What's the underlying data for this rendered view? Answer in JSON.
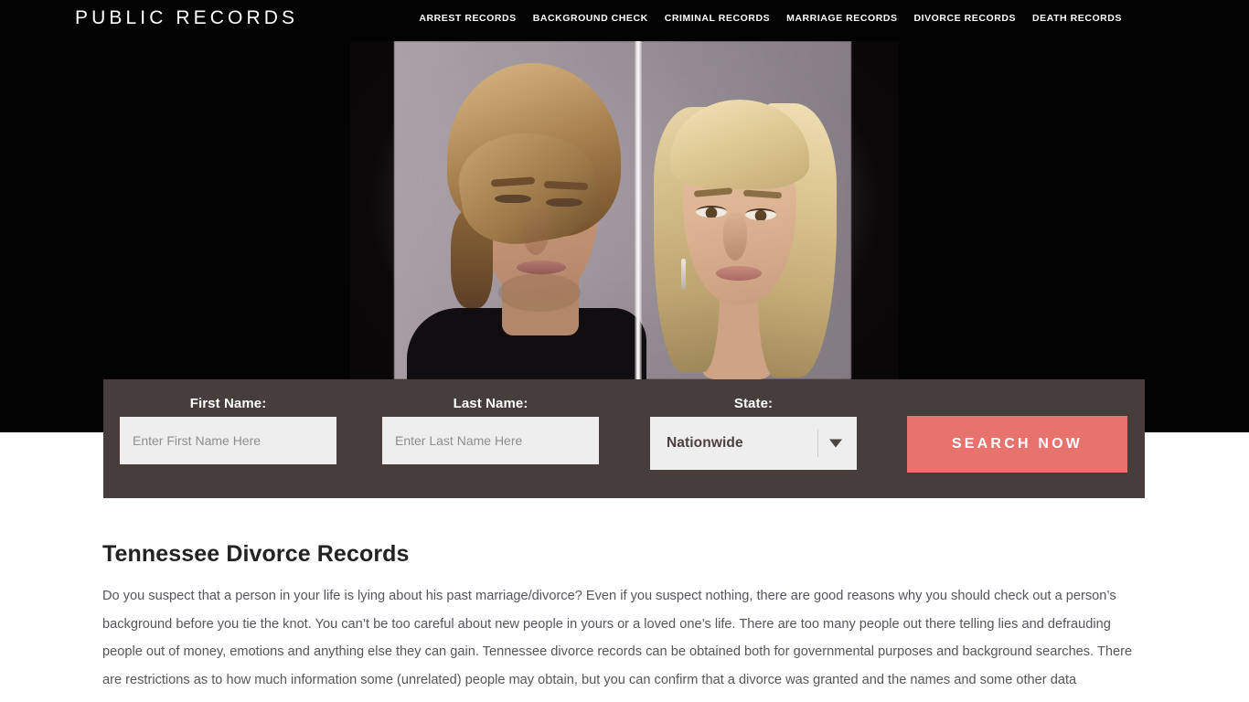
{
  "header": {
    "brand": "PUBLIC RECORDS",
    "nav": [
      {
        "label": "ARREST RECORDS"
      },
      {
        "label": "BACKGROUND CHECK"
      },
      {
        "label": "CRIMINAL RECORDS"
      },
      {
        "label": "MARRIAGE RECORDS"
      },
      {
        "label": "DIVORCE RECORDS"
      },
      {
        "label": "DEATH RECORDS"
      }
    ]
  },
  "hero": {
    "image_alt": "Man and woman facing away from each other split by a bright vertical divider"
  },
  "search_form": {
    "first_name": {
      "label": "First Name:",
      "placeholder": "Enter First Name Here",
      "value": ""
    },
    "last_name": {
      "label": "Last Name:",
      "placeholder": "Enter Last Name Here",
      "value": ""
    },
    "state": {
      "label": "State:",
      "selected": "Nationwide",
      "icon": "chevron-down-icon"
    },
    "submit_label": "SEARCH NOW",
    "colors": {
      "panel": "#473e3c",
      "button": "#e8726c",
      "input": "#eeeeee"
    }
  },
  "article": {
    "title": "Tennessee Divorce Records",
    "body": "Do you suspect that a person in your life is lying about his past marriage/divorce? Even if you suspect nothing, there are good reasons why you should check out a person’s background before you tie the knot. You can’t be too careful about new people in yours or a loved one’s life. There are too many people out there telling lies and defrauding people out of money, emotions and anything else they can gain. Tennessee divorce records can be obtained both for governmental purposes and background searches. There are restrictions as to how much information some (unrelated) people may obtain, but you can confirm that a divorce was granted and the names and some other data"
  }
}
